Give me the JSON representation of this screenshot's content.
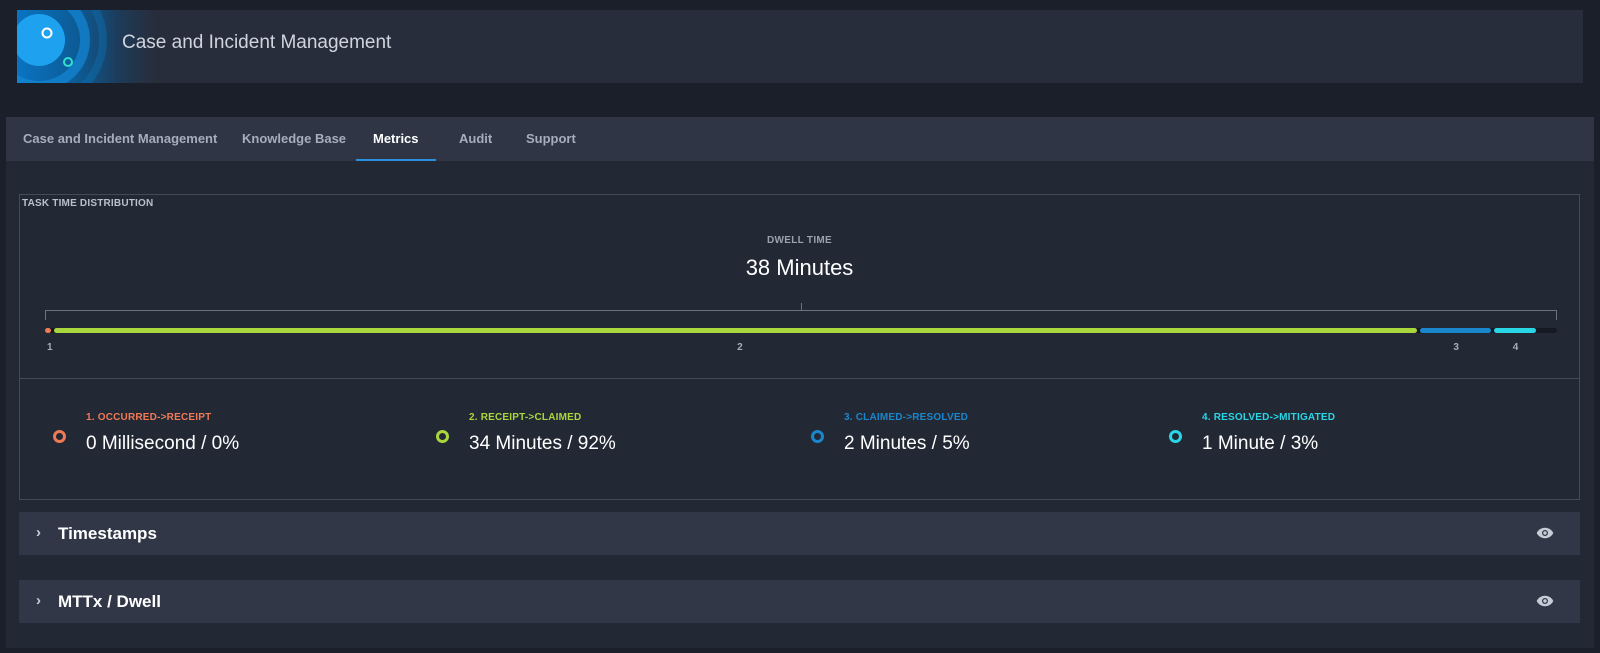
{
  "app": {
    "title": "Case and Incident Management"
  },
  "tabs": [
    {
      "label": "Case and Incident Management"
    },
    {
      "label": "Knowledge Base"
    },
    {
      "label": "Metrics"
    },
    {
      "label": "Audit"
    },
    {
      "label": "Support"
    }
  ],
  "active_tab": "Metrics",
  "task_time": {
    "title": "TASK TIME DISTRIBUTION",
    "dwell_label": "DWELL TIME",
    "dwell_value": "38 Minutes",
    "segments": [
      {
        "marker": "1",
        "label": "1. OCCURRED->RECEIPT",
        "value": "0 Millisecond / 0%",
        "share": 0.0,
        "color": "#ef7a55"
      },
      {
        "marker": "2",
        "label": "2. RECEIPT->CLAIMED",
        "value": "34 Minutes / 92%",
        "share": 0.92,
        "color": "#a8d63c"
      },
      {
        "marker": "3",
        "label": "3. CLAIMED->RESOLVED",
        "value": "2 Minutes / 5%",
        "share": 0.05,
        "color": "#1a86cc"
      },
      {
        "marker": "4",
        "label": "4. RESOLVED->MITIGATED",
        "value": "1 Minute / 3%",
        "share": 0.03,
        "color": "#28d6e6"
      }
    ]
  },
  "sections": [
    {
      "title": "Timestamps",
      "chevron_icon": "chevron-right-icon",
      "action_icon": "eye-icon"
    },
    {
      "title": "MTTx / Dwell",
      "chevron_icon": "chevron-right-icon",
      "action_icon": "eye-icon"
    }
  ]
}
